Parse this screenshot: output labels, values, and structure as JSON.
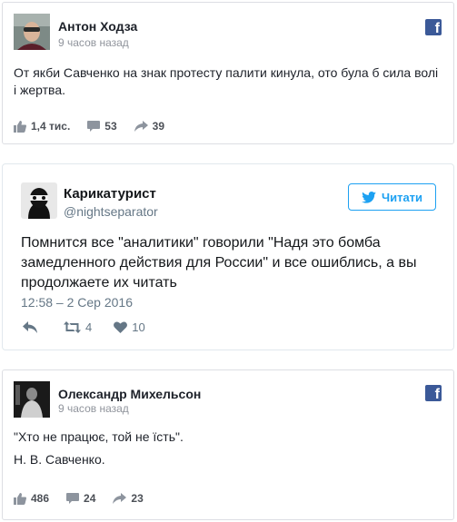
{
  "posts": [
    {
      "type": "facebook",
      "author": "Антон Ходза",
      "time": "9 часов назад",
      "text": "От якби Савченко на знак протесту палити кинула, ото була б сила волі і жертва.",
      "likes": "1,4 тис.",
      "comments": "53",
      "shares": "39",
      "brand_icon": "facebook-icon"
    },
    {
      "type": "twitter",
      "author": "Карикатурист",
      "handle": "@nightseparator",
      "follow_label": "Читати",
      "text": "Помнится все \"аналитики\" говорили \"Надя это бомба замедленного действия для России\" и все ошиблись, а вы продолжаете их читать",
      "timestamp": "12:58 – 2 Сер 2016",
      "retweets": "4",
      "likes": "10",
      "brand_icon": "twitter-bird-icon"
    },
    {
      "type": "facebook",
      "author": "Олександр Михельсон",
      "time": "9 часов назад",
      "text_line1": "\"Хто не працює, той не їсть\".",
      "text_line2": "Н. В. Савченко.",
      "likes": "486",
      "comments": "24",
      "shares": "23",
      "brand_icon": "facebook-icon"
    }
  ],
  "colors": {
    "facebook_blue": "#3b5998",
    "twitter_blue": "#1da1f2"
  }
}
